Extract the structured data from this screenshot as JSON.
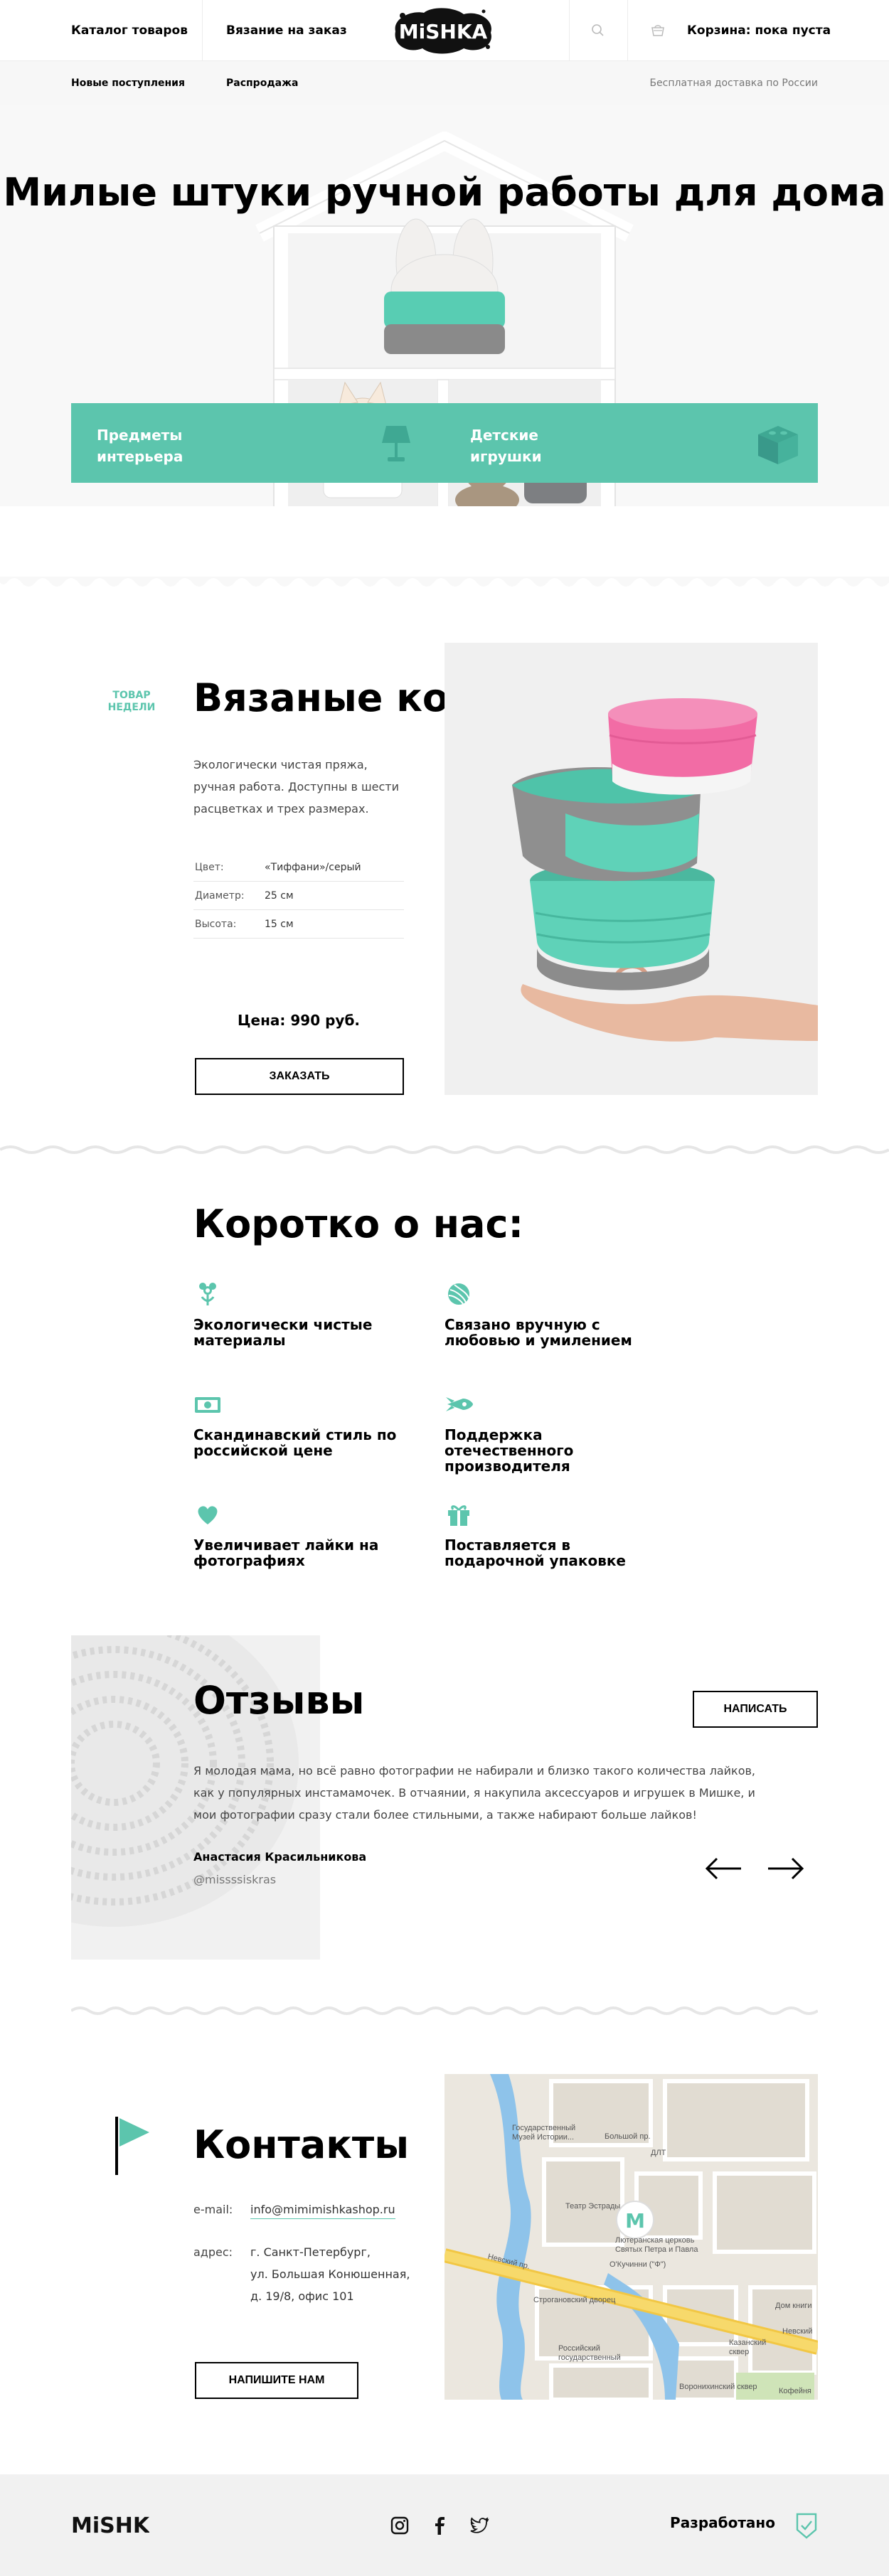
{
  "header": {
    "nav_catalog": "Каталог товаров",
    "nav_knitting": "Вязание на заказ",
    "logo_text": "MiSHKA",
    "cart_label": "Корзина: пока пуста",
    "icons": [
      "search-icon",
      "cart-icon"
    ]
  },
  "subnav": {
    "new_arrivals": "Новые поступления",
    "sale": "Распродажа",
    "delivery": "Бесплатная доставка по России"
  },
  "hero": {
    "title": "Милые штуки ручной работы для дома",
    "promo": [
      {
        "label": "Предметы интерьера",
        "icon": "lamp-icon"
      },
      {
        "label": "Детские игрушки",
        "icon": "toy-block-icon"
      }
    ]
  },
  "product": {
    "badge": "ТОВАР НЕДЕЛИ",
    "title": "Вязаные корзинки",
    "description": "Экологически чистая пряжа, ручная работа. Доступны в шести расцветках и трех размерах.",
    "specs": [
      {
        "key": "Цвет:",
        "value": "«Тиффани»/серый"
      },
      {
        "key": "Диаметр:",
        "value": "25 см"
      },
      {
        "key": "Высота:",
        "value": "15 см"
      }
    ],
    "price": "Цена: 990 руб.",
    "order_button": "ЗАКАЗАТЬ"
  },
  "about": {
    "title": "Коротко о нас:",
    "features": [
      {
        "text": "Экологически чистые материалы",
        "icon": "eco-flower-icon"
      },
      {
        "text": "Связано вручную с любовью и умилением",
        "icon": "yarn-ball-icon"
      },
      {
        "text": "Скандинавский стиль по российской цене",
        "icon": "money-icon"
      },
      {
        "text": "Поддержка отечественного производителя",
        "icon": "rocket-icon"
      },
      {
        "text": "Увеличивает лайки на фотографиях",
        "icon": "heart-icon"
      },
      {
        "text": "Поставляется в подарочной упаковке",
        "icon": "gift-icon"
      }
    ]
  },
  "reviews": {
    "title": "Отзывы",
    "write_button": "НАПИСАТЬ",
    "text": "Я молодая мама, но всё равно фотографии не набирали и близко такого количества лайков, как у популярных инстамамочек. В отчаянии, я накупила аксессуаров и игрушек в Мишке, и мои фотографии сразу стали более стильными, а также набирают больше лайков!",
    "author": "Анастасия Красильникова",
    "handle": "@missssiskras",
    "icons": [
      "arrow-left-icon",
      "arrow-right-icon"
    ]
  },
  "contacts": {
    "title": "Контакты",
    "email_label": "e-mail:",
    "email": "info@mimimishkashop.ru",
    "address_label": "адрес:",
    "address_lines": [
      "г. Санкт-Петербург,",
      "ул. Большая Конюшенная,",
      "д. 19/8, офис 101"
    ],
    "write_button": "НАПИШИТЕ НАМ",
    "map_labels": [
      "Государственный Музей Истории...",
      "Большой пр.",
      "ДЛТ",
      "Театр Эстрады",
      "Лютеранская церковь Святых Петра и Павла",
      "О'Кучинни (\"Ф\")",
      "Невский пр.",
      "Строгановский дворец",
      "Российский государственный",
      "Казанский сквер",
      "Воронихинский сквер",
      "Дом книги",
      "Невский",
      "Кофейня"
    ],
    "map_marker_letter": "M"
  },
  "footer": {
    "logo_text": "MiSHKA",
    "social_icons": [
      "instagram-icon",
      "facebook-icon",
      "twitter-icon"
    ],
    "made_by": "Разработано"
  },
  "colors": {
    "accent": "#5cc5ad",
    "text": "#000000",
    "muted": "#777777",
    "light_bg": "#f7f7f7"
  }
}
